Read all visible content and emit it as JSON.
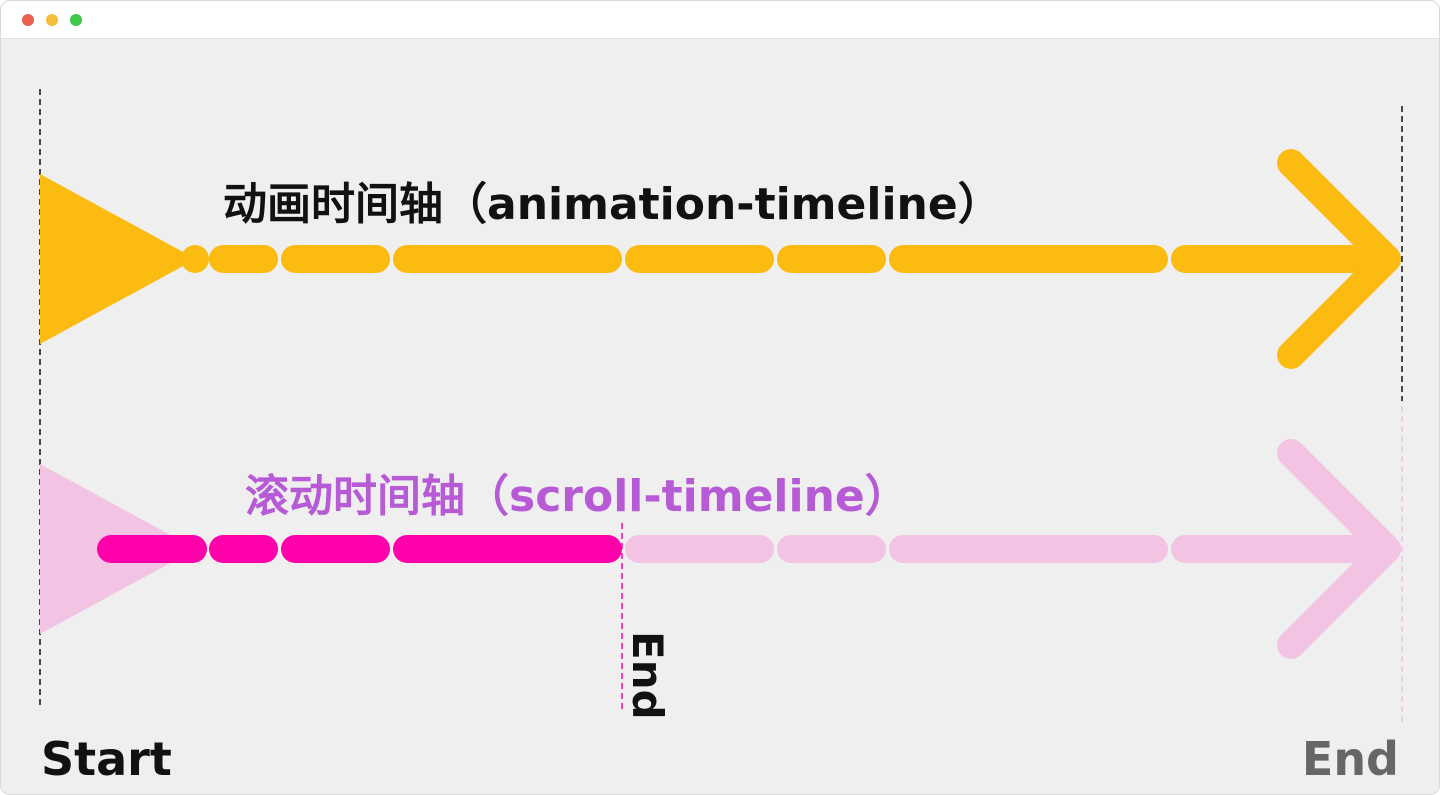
{
  "window": {
    "controls": {
      "close_color": "#ec5f4f",
      "minimize_color": "#f4be3a",
      "zoom_color": "#3fc84a"
    }
  },
  "diagram": {
    "animation_timeline": {
      "label": "动画时间轴（animation-timeline）",
      "color": "#fbbb10",
      "label_color": "#111111"
    },
    "scroll_timeline": {
      "label": "滚动时间轴（scroll-timeline）",
      "active_color": "#ff00aa",
      "faded_color": "#f2c3e3",
      "label_color": "#b65ad6"
    },
    "markers": {
      "start_label": "Start",
      "start_color": "#111111",
      "end_label": "End",
      "end_color": "#666666",
      "scroll_end_label": "End",
      "scroll_end_color": "#111111"
    }
  }
}
